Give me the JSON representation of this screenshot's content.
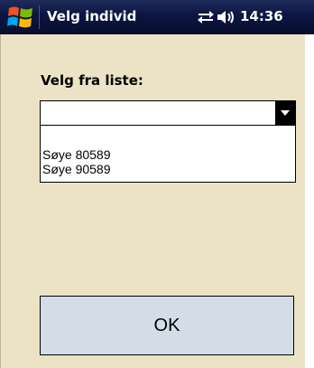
{
  "window": {
    "title": "Velg individ",
    "start_icon": "windows-flag-icon",
    "connectivity_icon": "connectivity-arrows-icon",
    "volume_icon": "speaker-volume-icon",
    "clock": "14:36"
  },
  "form": {
    "label": "Velg fra liste:",
    "select": {
      "selected_value": "",
      "options": [
        "Søye 80589",
        "Søye 90589"
      ]
    },
    "ok_button": "OK"
  },
  "colors": {
    "titlebar": "#0c1640",
    "background": "#ece3c6",
    "button": "#d3dde8"
  }
}
